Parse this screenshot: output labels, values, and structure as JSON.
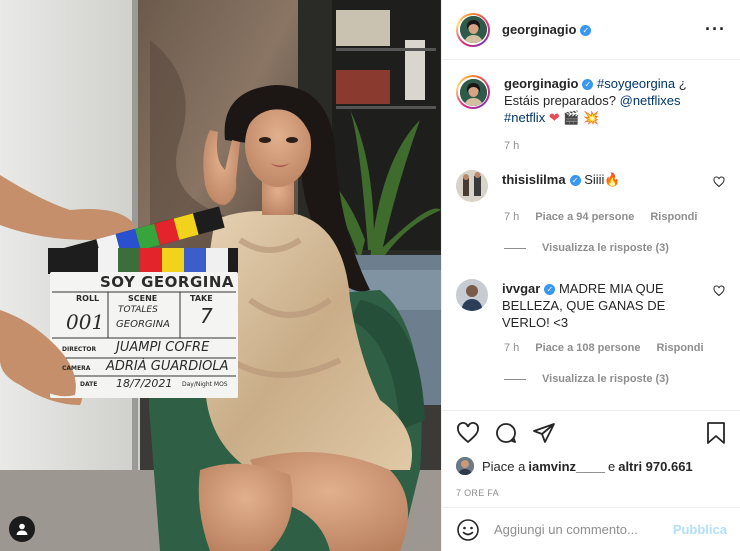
{
  "post": {
    "username": "georginagio",
    "more_icon": "more-options-icon"
  },
  "photo": {
    "clapboard": {
      "title": "SOY GEORGINA",
      "roll_label": "ROLL",
      "scene_label": "SCENE",
      "take_label": "TAKE",
      "roll_value": "001",
      "scene_value_1": "TOTALES",
      "scene_value_2": "GEORGINA",
      "take_value": "7",
      "director_label": "DIRECTOR",
      "director_value": "JUAMPI COFRE",
      "camera_label": "CAMERA",
      "camera_value": "ADRIÀ GUARDIOLA",
      "date_label": "DATE",
      "date_value": "18/7/2021",
      "daynight_label": "Day/Night MOS"
    }
  },
  "caption": {
    "username": "georginagio",
    "hashtag1": "#soygeorgina",
    "text1": " ¿ Estáis preparados? ",
    "mention": "@netflixes",
    "hashtag2": "#netflix",
    "emojis": "❤ 🎬 💥",
    "time": "7 h"
  },
  "comments": [
    {
      "username": "thisislilma",
      "text": "Siiii🔥",
      "time": "7 h",
      "likes": "Piace a 94 persone",
      "reply": "Rispondi",
      "view_replies": "Visualizza le risposte (3)"
    },
    {
      "username": "ivvgar",
      "text": "MADRE MIA QUE BELLEZA, QUE GANAS DE VERLO! <3",
      "time": "7 h",
      "likes": "Piace a 108 persone",
      "reply": "Rispondi",
      "view_replies": "Visualizza le risposte (3)"
    }
  ],
  "likes_line": {
    "prefix": "Piace a ",
    "user": "iamvinz____",
    "middle": " e ",
    "others": "altri 970.661"
  },
  "time_ago": "7 ORE FA",
  "add_comment": {
    "placeholder": "Aggiungi un commento...",
    "publish": "Pubblica"
  },
  "colors": {
    "accent": "#3897f0",
    "publish_disabled": "#b2dffc",
    "heart": "#ed4956"
  }
}
